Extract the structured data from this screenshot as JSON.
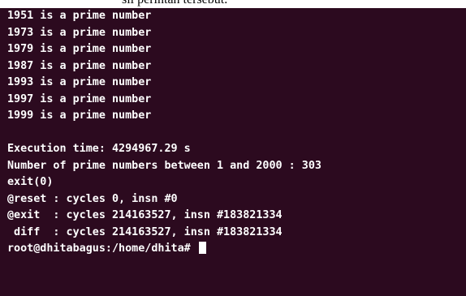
{
  "caption_fragment": "sil perintah tersebut.",
  "terminal": {
    "lines": [
      "1951 is a prime number",
      "1973 is a prime number",
      "1979 is a prime number",
      "1987 is a prime number",
      "1993 is a prime number",
      "1997 is a prime number",
      "1999 is a prime number",
      "",
      "Execution time: 4294967.29 s",
      "Number of prime numbers between 1 and 2000 : 303",
      "exit(0)",
      "@reset : cycles 0, insn #0",
      "@exit  : cycles 214163527, insn #183821334",
      " diff  : cycles 214163527, insn #183821334"
    ],
    "prompt": "root@dhitabagus:/home/dhita# "
  }
}
